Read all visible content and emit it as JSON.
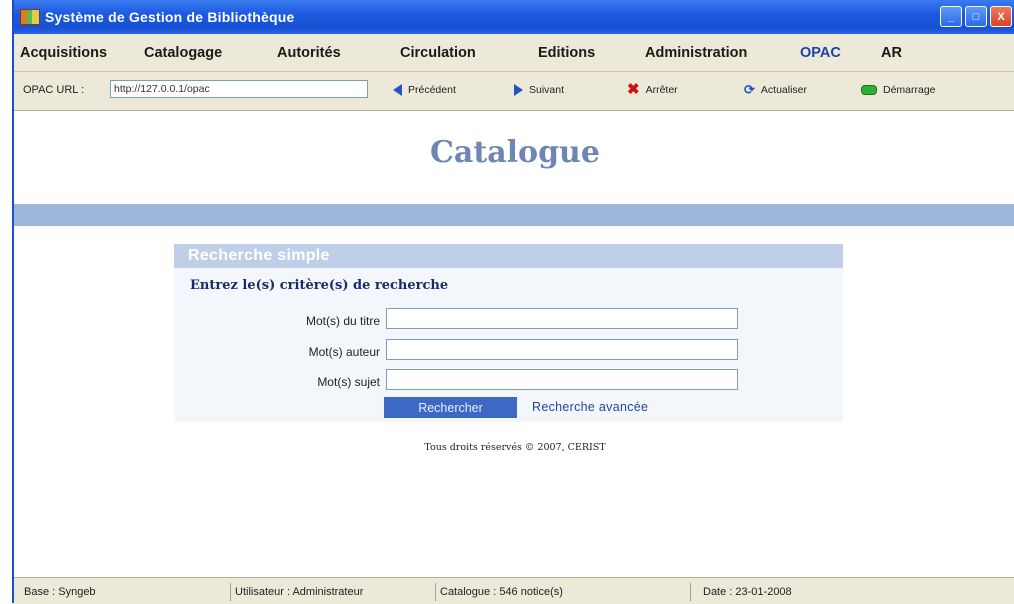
{
  "window": {
    "title": "Système de Gestion de Bibliothèque",
    "controls": {
      "minimize": "_",
      "maximize": "□",
      "close": "X"
    }
  },
  "menu": {
    "items": [
      {
        "label": "Acquisitions"
      },
      {
        "label": "Catalogage"
      },
      {
        "label": "Autorités"
      },
      {
        "label": "Circulation"
      },
      {
        "label": "Editions"
      },
      {
        "label": "Administration"
      },
      {
        "label": "OPAC"
      },
      {
        "label": "AR"
      }
    ]
  },
  "toolbar": {
    "url_label": "OPAC URL :",
    "url_value": "http://127.0.0.1/opac",
    "previous": "Précédent",
    "next": "Suivant",
    "stop": "Arrêter",
    "refresh": "Actualiser",
    "start": "Démarrage"
  },
  "page": {
    "title": "Catalogue",
    "search": {
      "header": "Recherche simple",
      "subtitle": "Entrez le(s) critère(s) de recherche",
      "title_label": "Mot(s) du titre",
      "author_label": "Mot(s) auteur",
      "subject_label": "Mot(s) sujet",
      "submit": "Rechercher",
      "advanced": "Recherche avancée"
    },
    "copyright": "Tous droits réservés © 2007, CERIST"
  },
  "status": {
    "base": "Base : Syngeb",
    "user": "Utilisateur : Administrateur",
    "catalogue": "Catalogue : 546 notice(s)",
    "date": "Date : 23-01-2008"
  },
  "colors": {
    "titlebar": "#1d5ae0",
    "menu_active": "#1f3fa8",
    "page_title": "#6d86b4",
    "band": "#9fb6dc",
    "search_button": "#3d68c4"
  }
}
